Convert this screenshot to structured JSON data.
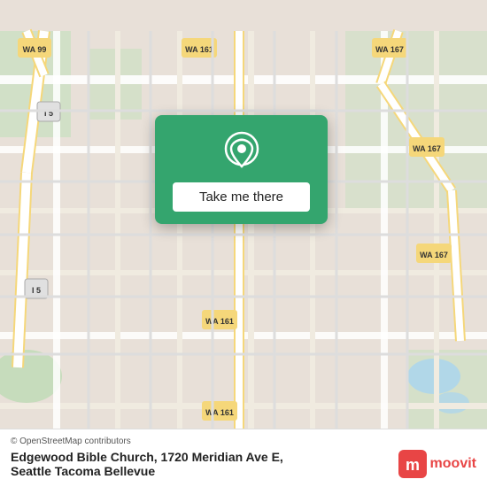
{
  "map": {
    "background_color": "#e8e0d8",
    "road_color": "#ffffff",
    "highway_color": "#f5d77a",
    "water_color": "#a8d4f0",
    "green_color": "#c8dfc0"
  },
  "card": {
    "background_color": "#34a56e",
    "button_label": "Take me there",
    "pin_color": "#ffffff"
  },
  "bottom_bar": {
    "attribution": "© OpenStreetMap contributors",
    "location_text": "Edgewood Bible Church, 1720 Meridian Ave E,",
    "location_subtext": "Seattle Tacoma Bellevue",
    "moovit_label": "moovit"
  },
  "route_labels": {
    "wa99": "WA 99",
    "wa161_top": "WA 161",
    "wa161_mid": "WA 161",
    "wa161_bot": "WA 161",
    "wa167_top": "WA 167",
    "wa167_mid1": "WA 167",
    "wa167_mid2": "WA 167",
    "i5_top": "I5",
    "i5_bot": "I5"
  }
}
